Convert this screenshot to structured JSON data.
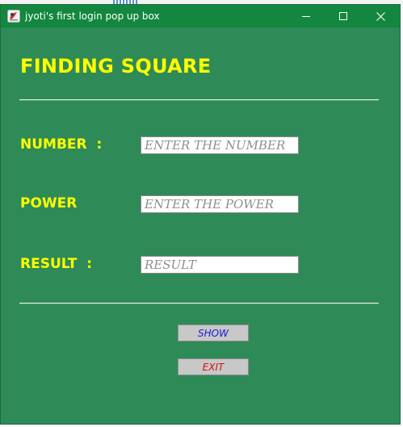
{
  "window": {
    "title": "jyoti's first login pop up box",
    "icon": "java-app-icon",
    "controls": {
      "minimize_icon": "minimize-icon",
      "maximize_icon": "maximize-icon",
      "close_icon": "close-icon"
    }
  },
  "form": {
    "heading": "FINDING SQUARE",
    "number": {
      "label": "NUMBER  :",
      "placeholder": "ENTER THE NUMBER",
      "value": ""
    },
    "power": {
      "label": "POWER",
      "placeholder": "ENTER THE POWER",
      "value": ""
    },
    "result": {
      "label": "RESULT  :",
      "placeholder": "RESULT",
      "value": ""
    },
    "buttons": {
      "show_label": "SHOW",
      "exit_label": "EXIT"
    }
  },
  "colors": {
    "window_background": "#2e8b57",
    "titlebar_background": "#13873f",
    "label_color": "#ffff00",
    "show_text_color": "#1b1bd6",
    "exit_text_color": "#d80f0f",
    "button_background": "#c8c8c8"
  }
}
